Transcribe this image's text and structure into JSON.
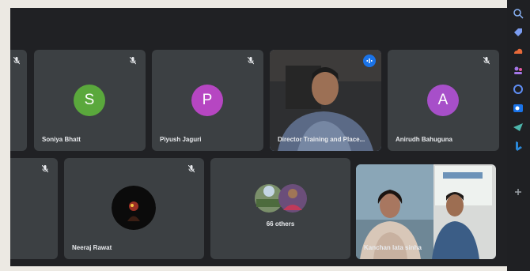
{
  "participants": [
    {
      "name": "Soniya Bhatt",
      "initial": "S",
      "color": "#5aa83c"
    },
    {
      "name": "Piyush Jaguri",
      "initial": "P",
      "color": "#b646c2"
    },
    {
      "name": "Director Training and Place...",
      "initial": "",
      "color": ""
    },
    {
      "name": "Anirudh Bahuguna",
      "initial": "A",
      "color": "#a74fc9"
    },
    {
      "name": "Neeraj Rawat",
      "initial": "",
      "color": ""
    },
    {
      "name": "Kanchan lata sinha",
      "initial": "",
      "color": ""
    }
  ],
  "others": {
    "label": "66 others"
  },
  "sidebar_icons": [
    "search-icon",
    "tag-icon",
    "cloud-icon",
    "people-icon",
    "copilot-icon",
    "outlook-icon",
    "send-icon",
    "bing-icon",
    "add-icon"
  ],
  "accent_color": "#8ab4f8"
}
